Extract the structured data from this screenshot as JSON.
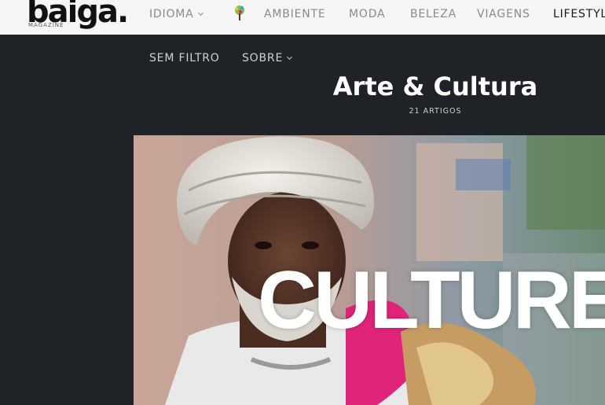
{
  "brand": {
    "name": "baiga.",
    "subtitle": "MAGAZINE"
  },
  "nav": {
    "items": [
      {
        "label": "IDIOMA",
        "has_dropdown": true
      },
      {
        "label": "AMBIENTE",
        "icon": "tree-icon"
      },
      {
        "label": "MODA"
      },
      {
        "label": "BELEZA"
      },
      {
        "label": "VIAGENS"
      },
      {
        "label": "LIFESTYL",
        "active": true
      }
    ],
    "secondary": [
      {
        "label": "SEM FILTRO"
      },
      {
        "label": "SOBRE",
        "has_dropdown": true
      }
    ]
  },
  "category": {
    "title": "Arte & Cultura",
    "count": "21 ARTIGOS"
  },
  "hero": {
    "overlay_text": "CULTURE"
  },
  "colors": {
    "topbar": "#f6f6f6",
    "page_bg": "#1f2227",
    "accent_pink": "#e0247a"
  }
}
